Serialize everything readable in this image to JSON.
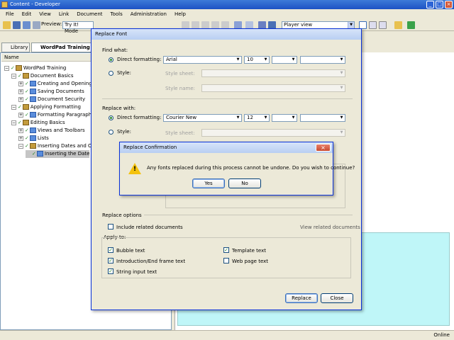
{
  "window": {
    "title": "Content - Developer",
    "min": "_",
    "max": "□",
    "close": "×"
  },
  "menu": [
    "File",
    "Edit",
    "View",
    "Link",
    "Document",
    "Tools",
    "Administration",
    "Help"
  ],
  "toolbar": {
    "preview_label": "Preview:",
    "preview_mode": "Try It! Mode",
    "player_view": "Player view"
  },
  "tabs": {
    "library": "Library",
    "project": "WordPad Training"
  },
  "tree": {
    "column": "Name",
    "items": [
      {
        "label": "WordPad Training",
        "level": 0,
        "type": "book"
      },
      {
        "label": "Document Basics",
        "level": 1,
        "type": "book"
      },
      {
        "label": "Creating and Opening D",
        "level": 2,
        "type": "doc"
      },
      {
        "label": "Saving Documents",
        "level": 2,
        "type": "doc"
      },
      {
        "label": "Document Security",
        "level": 2,
        "type": "doc"
      },
      {
        "label": "Applying Formatting",
        "level": 1,
        "type": "book"
      },
      {
        "label": "Formatting Paragraphs",
        "level": 2,
        "type": "doc"
      },
      {
        "label": "Editing Basics",
        "level": 1,
        "type": "book"
      },
      {
        "label": "Views and Toolbars",
        "level": 2,
        "type": "doc"
      },
      {
        "label": "Lists",
        "level": 2,
        "type": "doc"
      },
      {
        "label": "Inserting Dates and Obj",
        "level": 2,
        "type": "book"
      },
      {
        "label": "Inserting the Date",
        "level": 3,
        "type": "doc"
      }
    ]
  },
  "replace_font": {
    "title": "Replace Font",
    "find_what": "Find what:",
    "replace_with": "Replace with:",
    "direct_formatting": "Direct formatting:",
    "style": "Style:",
    "style_sheet": "Style sheet:",
    "style_name": "Style name:",
    "find_font": "Arial",
    "find_size": "10",
    "replace_font": "Courier New",
    "replace_size": "12",
    "replace_options": "Replace options",
    "include_related": "Include related documents",
    "view_related": "View related documents",
    "apply_to": "Apply to:",
    "bubble_text": "Bubble text",
    "intro_end": "Introduction/End frame text",
    "string_input": "String input text",
    "template_text": "Template text",
    "web_page_text": "Web page text",
    "replace_btn": "Replace",
    "close_btn": "Close"
  },
  "confirm": {
    "title": "Replace Confirmation",
    "message": "Any fonts replaced during this process cannot be undone. Do you wish to continue?",
    "yes": "Yes",
    "no": "No",
    "close": "×"
  },
  "status": {
    "online": "Online"
  },
  "colors": {
    "accent": "#0831d9",
    "check": "#2a8a2a",
    "preview_bg": "#bff6f8"
  }
}
